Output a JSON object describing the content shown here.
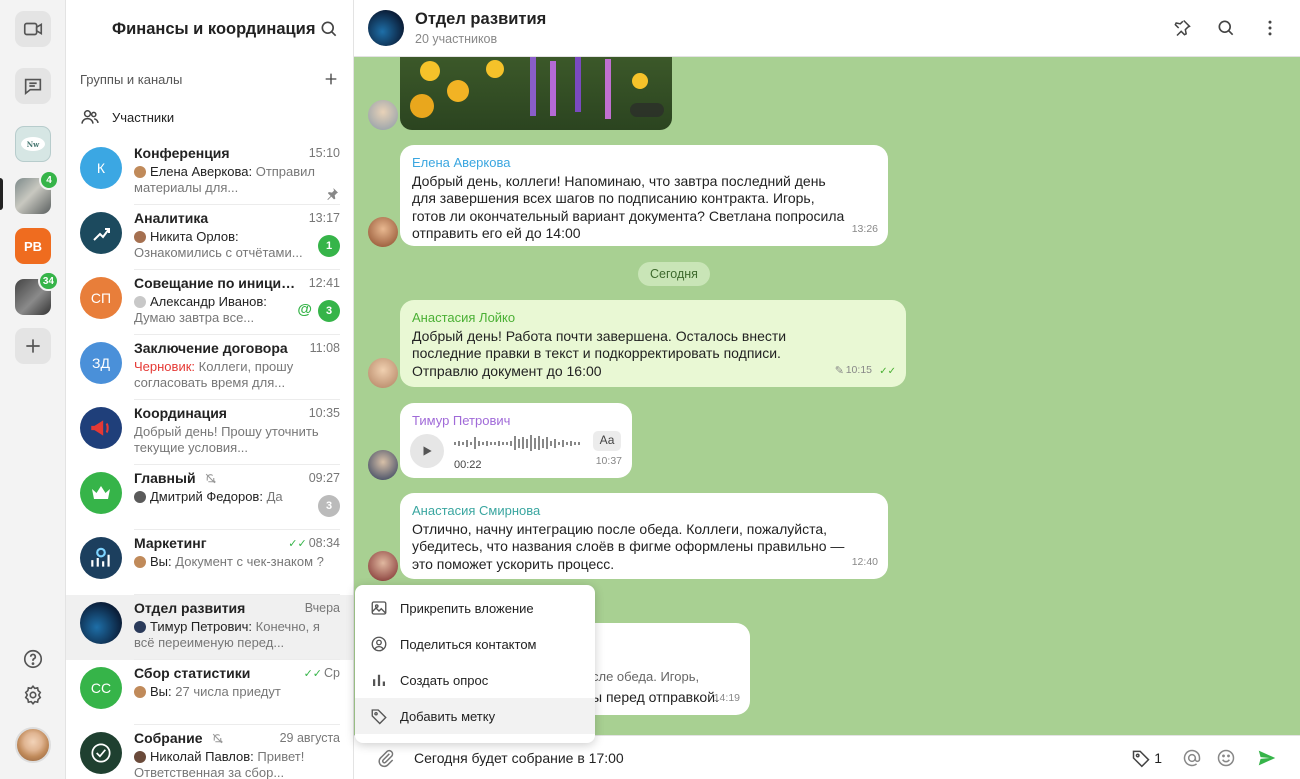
{
  "rail": {
    "workspaces": [
      {
        "initials": "",
        "badge": ""
      },
      {
        "initials": "",
        "badge": "4"
      },
      {
        "initials": "PB",
        "badge": ""
      },
      {
        "initials": "",
        "badge": "34"
      }
    ]
  },
  "panel": {
    "title": "Финансы и координация",
    "groups_label": "Группы и каналы",
    "members_label": "Участники"
  },
  "chats": [
    {
      "name": "Конференция",
      "time": "15:10",
      "author": "Елена Аверкова:",
      "text": "Отправил материалы для...",
      "initials": "К",
      "color": "#3ba7e3",
      "badge": "",
      "pinned": true
    },
    {
      "name": "Аналитика",
      "time": "13:17",
      "author": "Никита Орлов:",
      "text": "Ознакомились с  отчётами...",
      "initials": "",
      "color": "#1c4a5e",
      "badge": "1"
    },
    {
      "name": "Совещание по инициат...",
      "time": "12:41",
      "author": "Александр Иванов:",
      "text": "Думаю завтра все...",
      "initials": "СП",
      "color": "#e87e3a",
      "badge": "3",
      "mention": true
    },
    {
      "name": "Заключение договора",
      "time": "11:08",
      "author": "Черновик:",
      "text": "Коллеги, прошу согласовать время для...",
      "initials": "ЗД",
      "color": "#4a90d9",
      "badge": ""
    },
    {
      "name": "Координация",
      "time": "10:35",
      "author": "",
      "text": "Добрый день! Прошу уточнить текущие условия...",
      "initials": "",
      "color": "#1f3f7a",
      "badge": ""
    },
    {
      "name": "Главный",
      "time": "09:27",
      "author": "Дмитрий Федоров:",
      "text": "Да",
      "initials": "",
      "color": "#36b449",
      "badge": "3",
      "muted": true
    },
    {
      "name": "Маркетинг",
      "time": "08:34",
      "author": "Вы:",
      "text": "Документ с чек-знаком ?",
      "initials": "",
      "color": "#1c3f5e",
      "badge": ""
    },
    {
      "name": "Отдел развития",
      "time": "Вчера",
      "author": "Тимур Петрович:",
      "text": "Конечно, я всё переименую перед...",
      "initials": "",
      "color": "#0b1f3a",
      "badge": ""
    },
    {
      "name": "Сбор статистики",
      "time": "Ср",
      "author": "Вы:",
      "text": "27 числа приедут",
      "initials": "СС",
      "color": "#36b449",
      "badge": ""
    },
    {
      "name": "Собрание",
      "time": "29 августа",
      "author": "Николай Павлов:",
      "text": "Привет! Ответственная за сбор...",
      "initials": "",
      "color": "#1f4030",
      "badge": "",
      "muted": true
    }
  ],
  "header": {
    "title": "Отдел развития",
    "subtitle": "20 участников"
  },
  "messages": [
    {
      "author": "Елена Аверкова",
      "author_color": "#3aa6e0",
      "lines": [
        "Добрый день, коллеги! Напоминаю, что завтра последний день",
        "для завершения всех шагов по подписанию контракта. Игорь,",
        "готов ли окончательный вариант документа? Светлана попросила",
        "отправить его ей до 14:00"
      ],
      "time": "13:26"
    },
    {
      "author": "Анастасия Лойко",
      "author_color": "#4ab034",
      "lines": [
        "Добрый день! Работа почти завершена. Осталось внести",
        "последние правки в текст и подкорректировать подписи.",
        "Отправлю документ до 16:00"
      ],
      "time": "10:15"
    },
    {
      "author": "Анастасия Смирнова",
      "author_color": "#3aa6a0",
      "lines": [
        "Отлично, начну интеграцию после обеда. Коллеги, пожалуйста,",
        "убедитесь, что названия слоёв в фигме оформлены правильно —",
        "это поможет ускорить процесс."
      ],
      "time": "12:40"
    }
  ],
  "voice": {
    "author": "Тимур Петрович",
    "author_color": "#a06ad8",
    "duration": "00:22",
    "time": "10:37",
    "transcribe": "Аа"
  },
  "date_pill": "Сегодня",
  "partial_bubble": {
    "line1": "сле обеда. Игорь,",
    "line2": "ы перед отправкой.",
    "time": "14:19"
  },
  "attach_menu": [
    "Прикрепить вложение",
    "Поделиться контактом",
    "Создать опрос",
    "Добавить метку"
  ],
  "composer": {
    "text": "Сегодня будет собрание в 17:00",
    "tag_count": "1"
  }
}
